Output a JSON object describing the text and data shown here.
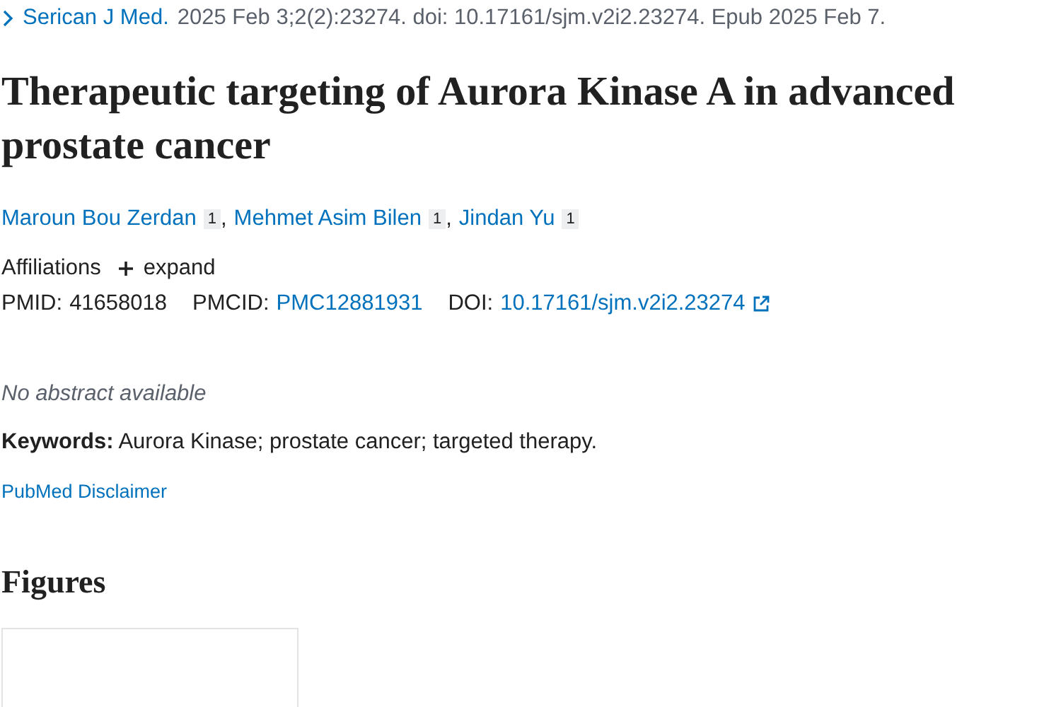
{
  "citation": {
    "journal": "Serican J Med.",
    "details": "2025 Feb 3;2(2):23274. doi: 10.17161/sjm.v2i2.23274. Epub 2025 Feb 7."
  },
  "title": "Therapeutic targeting of Aurora Kinase A in advanced prostate cancer",
  "authors": [
    {
      "name": "Maroun Bou Zerdan",
      "affiliation": "1",
      "separator": ","
    },
    {
      "name": "Mehmet Asim Bilen",
      "affiliation": "1",
      "separator": ","
    },
    {
      "name": "Jindan Yu",
      "affiliation": "1"
    }
  ],
  "affiliations": {
    "label": "Affiliations",
    "toggle": "expand",
    "expanded": false
  },
  "identifiers": [
    {
      "label": "PMID:",
      "value": "41658018",
      "link": false,
      "external": false
    },
    {
      "label": "PMCID:",
      "value": "PMC12881931",
      "link": true,
      "external": false
    },
    {
      "label": "DOI:",
      "value": "10.17161/sjm.v2i2.23274",
      "link": true,
      "external": true
    }
  ],
  "abstract": "No abstract available",
  "keywords": "**Keywords:** Aurora Kinase; prostate cancer; targeted therapy.",
  "disclaimer_link": "PubMed Disclaimer",
  "figures": {
    "heading": "Figures",
    "cards": [
      {
        "kind": "empty"
      }
    ]
  }
}
